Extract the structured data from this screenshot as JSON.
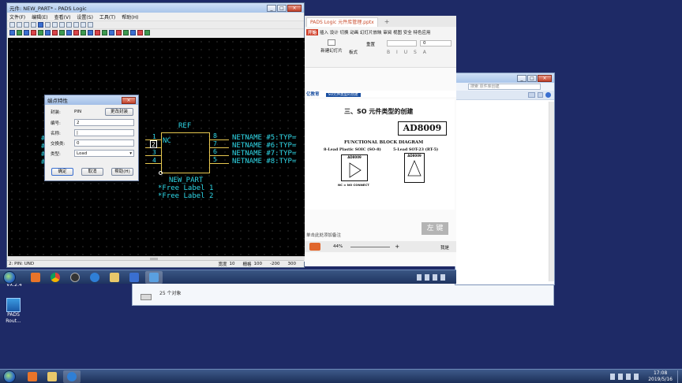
{
  "pads": {
    "title": "元件: NEW_PART* - PADS Logic",
    "menu": [
      "文件(F)",
      "编辑(E)",
      "查看(V)",
      "设置(S)",
      "工具(T)",
      "帮助(H)"
    ],
    "status": {
      "left": "2: PIN: UND",
      "width_label": "宽度",
      "width": "10",
      "grid_label": "栅格",
      "grid": "100",
      "x": "-200",
      "y": "300"
    },
    "part": {
      "ref": "REF",
      "nc": "NC",
      "pins_left": [
        "1",
        "2",
        "3",
        "4"
      ],
      "pins_right": [
        "8",
        "7",
        "6",
        "5"
      ],
      "name": "NEW_PART",
      "labels": [
        "*Free Label 1",
        "*Free Label 2"
      ],
      "netnames": [
        "NETNAME #5:TYP=",
        "NETNAME #6:TYP=",
        "NETNAME #7:TYP=",
        "NETNAME #8:TYP="
      ],
      "left_edge": [
        "#",
        "#",
        "#",
        "#"
      ]
    }
  },
  "dialog": {
    "title": "端点特性",
    "fields": [
      {
        "label": "封装:",
        "value": "PIN"
      },
      {
        "label": "编号:",
        "value": "2"
      },
      {
        "label": "名称:",
        "value": "|"
      },
      {
        "label": "交换类:",
        "value": "0"
      },
      {
        "label": "类型:",
        "value": "Load"
      }
    ],
    "change_pkg": "更改封装",
    "ok": "确定",
    "cancel": "取消",
    "help": "帮助(H)"
  },
  "ppt": {
    "tab": "PADS Logic 元件库管理.pptx",
    "ribbon_menu": "插入 设计 切换 动画 幻灯片放映 审阅 视图 安全 特色应用",
    "new_slide": "新建幻灯片",
    "layout": "板式",
    "reset": "重置",
    "font_size": "0",
    "brand": "亿教育",
    "slide_tag": "SO元件类型的创建",
    "heading": "三、SO 元件类型的创建",
    "part_number": "AD8009",
    "diagram_title": "FUNCTIONAL BLOCK DIAGRAM",
    "pkg1": "8-Lead Plastic SOIC (SO-8)",
    "pkg2": "5-Lead SOT-23 (RT-5)",
    "nc_note": "NC = NO CONNECT",
    "chip_label": "AD8009",
    "notes": "单击此处添加备注",
    "zoom": "44%",
    "watermark": "左 键",
    "share": "我是"
  },
  "explorer": {
    "search": "搜索 原件库创建",
    "count": "25 个对象"
  },
  "desktop": {
    "vx_label": "VX.2.4",
    "pads_icon": "PADS Rout..."
  },
  "clock": {
    "time": "17:08",
    "date": "2019/5/16"
  }
}
